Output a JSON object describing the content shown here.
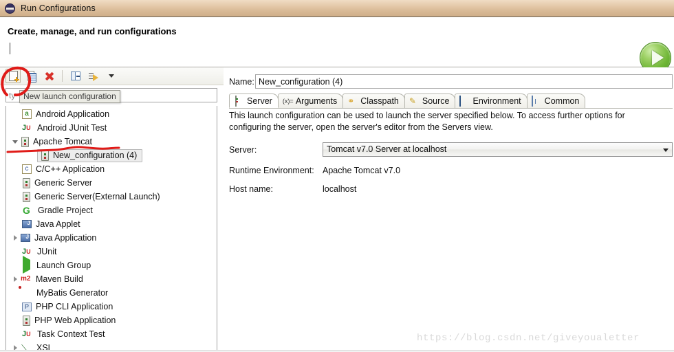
{
  "window": {
    "title": "Run Configurations",
    "icon": "eclipse-circle-icon"
  },
  "header": {
    "title": "Create, manage, and run configurations",
    "run_button_icon": "run-play-icon"
  },
  "toolbar": {
    "buttons": [
      {
        "name": "new-launch-configuration-button",
        "icon": "new-document-icon",
        "tooltip": "New launch configuration"
      },
      {
        "name": "duplicate-button",
        "icon": "duplicate-icon"
      },
      {
        "name": "delete-button",
        "icon": "delete-red-x-icon"
      },
      {
        "name": "collapse-all-button",
        "icon": "collapse-all-icon"
      },
      {
        "name": "filter-button",
        "icon": "filter-icon"
      },
      {
        "name": "filter-dropdown-button",
        "icon": "chevron-down-icon"
      }
    ],
    "tooltip_text": "New launch configuration"
  },
  "filter": {
    "value": "ty",
    "placeholder": "type filter text"
  },
  "tree": {
    "items": [
      {
        "label": "Android Application",
        "icon": "android-icon",
        "indent": 1,
        "twisty": "none"
      },
      {
        "label": "Android JUnit Test",
        "icon": "junit-android-icon",
        "indent": 1,
        "twisty": "none"
      },
      {
        "label": "Apache Tomcat",
        "icon": "server-icon",
        "indent": 0,
        "twisty": "open"
      },
      {
        "label": "New_configuration (4)",
        "icon": "server-icon",
        "indent": 2,
        "twisty": "none",
        "selected": true
      },
      {
        "label": "C/C++ Application",
        "icon": "c-application-icon",
        "indent": 1,
        "twisty": "none"
      },
      {
        "label": "Generic Server",
        "icon": "server-icon",
        "indent": 1,
        "twisty": "none"
      },
      {
        "label": "Generic Server(External Launch)",
        "icon": "server-icon",
        "indent": 1,
        "twisty": "none"
      },
      {
        "label": "Gradle Project",
        "icon": "gradle-icon",
        "indent": 1,
        "twisty": "none"
      },
      {
        "label": "Java Applet",
        "icon": "java-applet-icon",
        "indent": 1,
        "twisty": "none"
      },
      {
        "label": "Java Application",
        "icon": "java-application-icon",
        "indent": 0,
        "twisty": "closed"
      },
      {
        "label": "JUnit",
        "icon": "junit-icon",
        "indent": 1,
        "twisty": "none"
      },
      {
        "label": "Launch Group",
        "icon": "launch-group-icon",
        "indent": 1,
        "twisty": "none"
      },
      {
        "label": "Maven Build",
        "icon": "maven-icon",
        "indent": 0,
        "twisty": "closed"
      },
      {
        "label": "MyBatis Generator",
        "icon": "mybatis-icon",
        "indent": 1,
        "twisty": "none"
      },
      {
        "label": "PHP CLI Application",
        "icon": "php-cli-icon",
        "indent": 1,
        "twisty": "none"
      },
      {
        "label": "PHP Web Application",
        "icon": "server-icon",
        "indent": 1,
        "twisty": "none"
      },
      {
        "label": "Task Context Test",
        "icon": "junit-task-icon",
        "indent": 1,
        "twisty": "none"
      },
      {
        "label": "XSL",
        "icon": "xsl-icon",
        "indent": 0,
        "twisty": "closed"
      }
    ]
  },
  "details": {
    "name_label": "Name:",
    "name_value": "New_configuration (4)",
    "tabs": [
      {
        "label": "Server",
        "icon": "server-icon",
        "active": true
      },
      {
        "label": "Arguments",
        "icon": "arguments-icon",
        "active": false
      },
      {
        "label": "Classpath",
        "icon": "classpath-icon",
        "active": false
      },
      {
        "label": "Source",
        "icon": "source-icon",
        "active": false
      },
      {
        "label": "Environment",
        "icon": "environment-icon",
        "active": false
      },
      {
        "label": "Common",
        "icon": "common-icon",
        "active": false
      }
    ],
    "description": "This launch configuration can be used to launch the server specified below. To access further options for configuring the server, open the server's editor from the Servers view.",
    "server_label": "Server:",
    "server_value": "Tomcat v7.0 Server at localhost",
    "runtime_label": "Runtime Environment:",
    "runtime_value": "Apache Tomcat v7.0",
    "host_label": "Host name:",
    "host_value": "localhost"
  },
  "annotations": {
    "circle_color": "#e01b18",
    "underline_color": "#e01b18",
    "watermark": "https://blog.csdn.net/giveyoualetter"
  },
  "colors": {
    "titlebar": "#dec1a0",
    "accent_green": "#6fb636",
    "annotation_red": "#e01b18",
    "tree_selection": "#ededed"
  }
}
